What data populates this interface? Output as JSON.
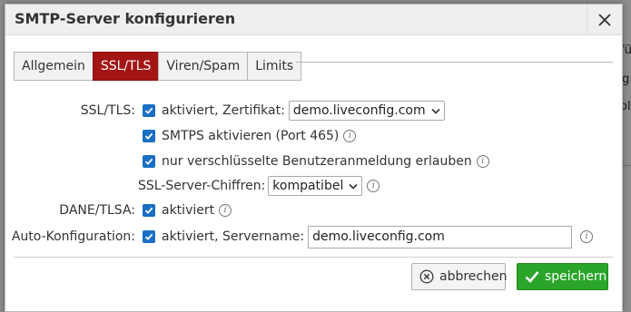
{
  "dialog": {
    "title": "SMTP-Server konfigurieren",
    "close_label": "✕"
  },
  "background_fragments": [
    "fü",
    "g",
    "ol"
  ],
  "tabs": [
    {
      "label": "Allgemein",
      "active": false
    },
    {
      "label": "SSL/TLS",
      "active": true
    },
    {
      "label": "Viren/Spam",
      "active": false
    },
    {
      "label": "Limits",
      "active": false
    }
  ],
  "form": {
    "ssl_tls": {
      "label": "SSL/TLS:",
      "enabled_text": "aktiviert, Zertifikat:",
      "enabled": true,
      "certificate": "demo.liveconfig.com"
    },
    "smtps": {
      "text": "SMTPS aktivieren (Port 465)",
      "checked": true
    },
    "encrypted_auth": {
      "text": "nur verschlüsselte Benutzeranmeldung erlauben",
      "checked": true
    },
    "ciphers": {
      "label": "SSL-Server-Chiffren:",
      "value": "kompatibel"
    },
    "dane": {
      "label": "DANE/TLSA:",
      "text": "aktiviert",
      "checked": true
    },
    "autoconfig": {
      "label": "Auto-Konfiguration:",
      "text": "aktiviert, Servername:",
      "checked": true,
      "servername": "demo.liveconfig.com"
    }
  },
  "buttons": {
    "cancel": "abbrechen",
    "save": "speichern"
  },
  "colors": {
    "active_tab": "#a31515",
    "checkbox": "#1a6fc4",
    "save": "#2aa52a"
  }
}
